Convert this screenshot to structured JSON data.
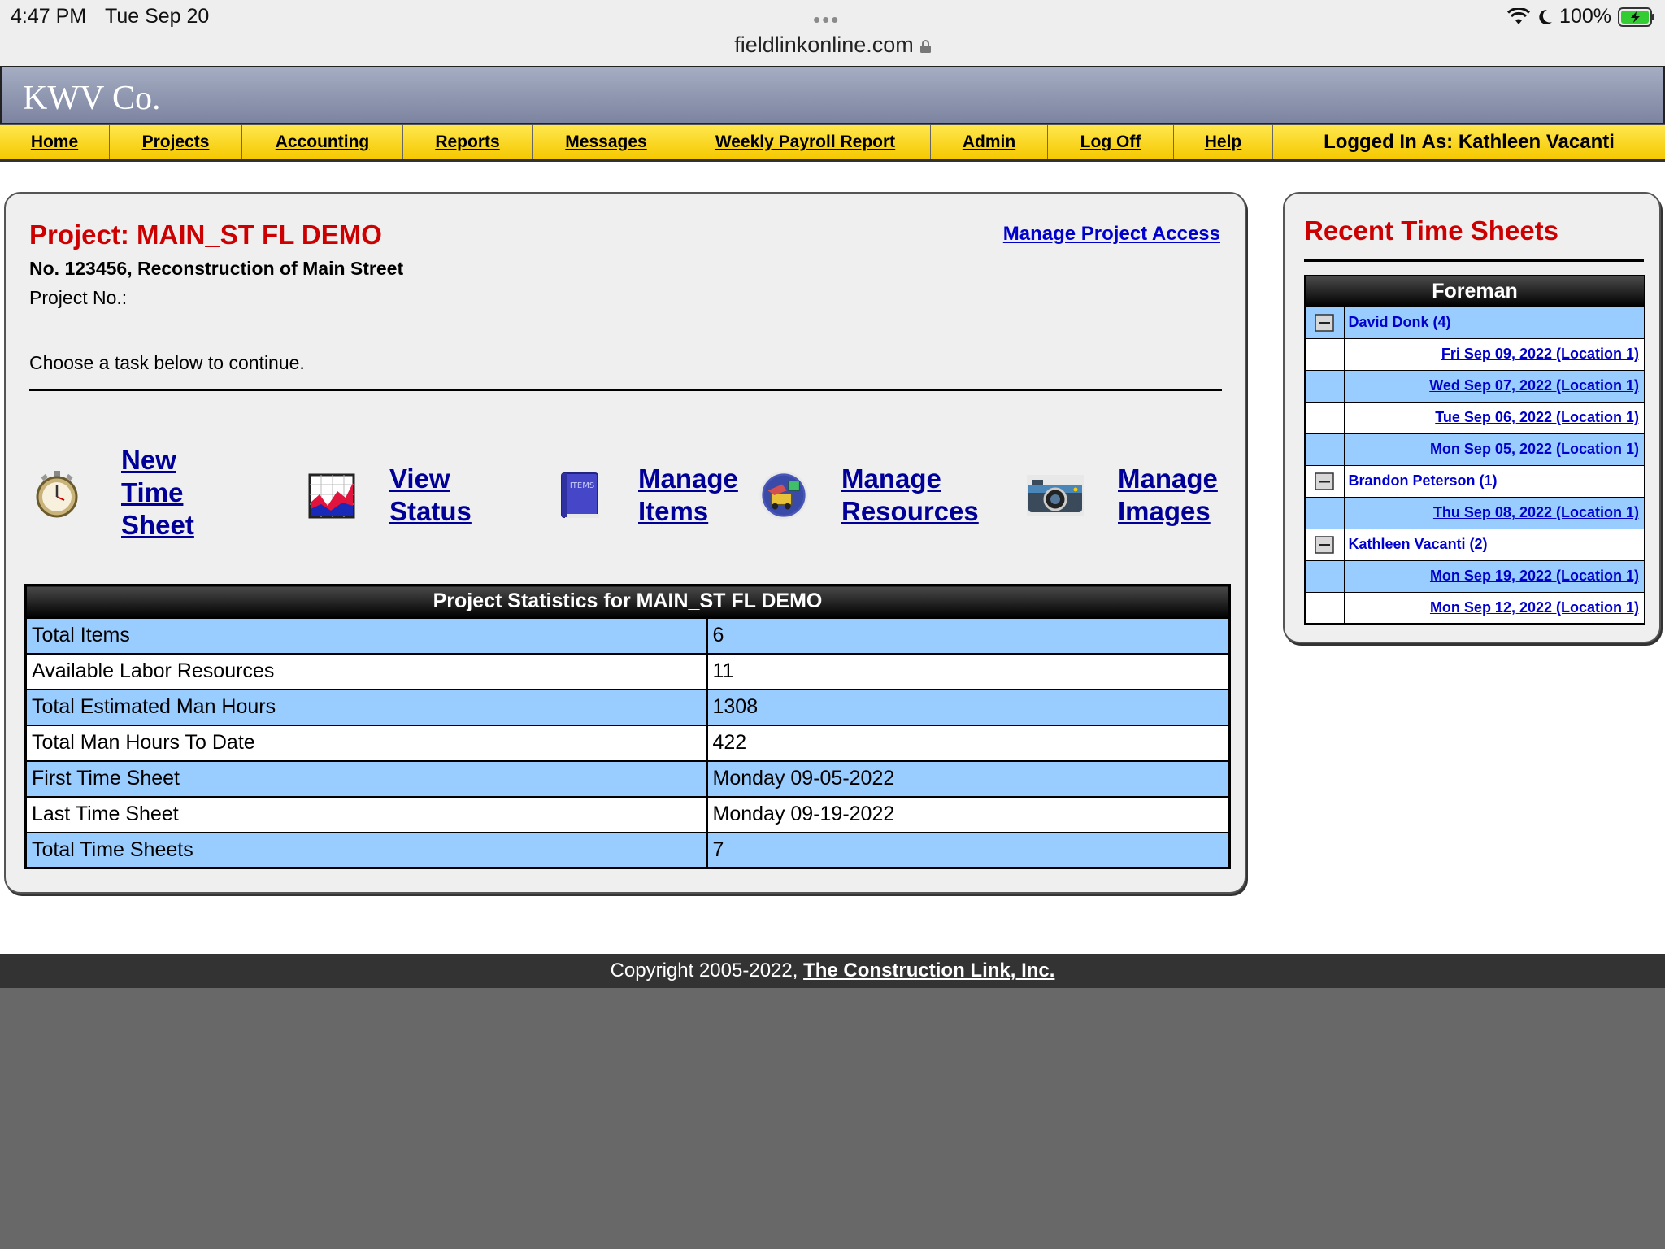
{
  "status_bar": {
    "time": "4:47 PM",
    "date": "Tue Sep 20",
    "battery": "100%"
  },
  "browser": {
    "dots": "•••",
    "url": "fieldlinkonline.com"
  },
  "banner": {
    "company": "KWV Co."
  },
  "nav": {
    "items": [
      "Home",
      "Projects",
      "Accounting",
      "Reports",
      "Messages",
      "Weekly Payroll Report",
      "Admin",
      "Log Off",
      "Help"
    ],
    "logged_in": "Logged In As: Kathleen Vacanti"
  },
  "project": {
    "title": "Project: MAIN_ST FL DEMO",
    "manage_access": "Manage Project Access",
    "description": "No. 123456, Reconstruction of Main Street",
    "project_no": "Project No.:",
    "choose_task": "Choose a task below to continue."
  },
  "tasks": {
    "new_time_sheet": [
      "New",
      "Time",
      "Sheet"
    ],
    "view_status": [
      "View",
      "Status"
    ],
    "manage_items": [
      "Manage",
      "Items"
    ],
    "manage_resources": [
      "Manage",
      "Resources"
    ],
    "manage_images": [
      "Manage",
      "Images"
    ],
    "items_icon_text": "ITEMS"
  },
  "stats": {
    "header": "Project Statistics for MAIN_ST FL DEMO",
    "rows": [
      {
        "label": "Total Items",
        "value": "6"
      },
      {
        "label": "Available Labor Resources",
        "value": "11"
      },
      {
        "label": "Total Estimated Man Hours",
        "value": "1308"
      },
      {
        "label": "Total Man Hours To Date",
        "value": "422"
      },
      {
        "label": "First Time Sheet",
        "value": "Monday 09-05-2022"
      },
      {
        "label": "Last Time Sheet",
        "value": "Monday 09-19-2022"
      },
      {
        "label": "Total Time Sheets",
        "value": "7"
      }
    ]
  },
  "recent": {
    "title": "Recent Time Sheets",
    "header": "Foreman",
    "groups": [
      {
        "name": "David Donk (4)",
        "dates": [
          "Fri Sep 09, 2022 (Location 1)",
          "Wed Sep 07, 2022 (Location 1)",
          "Tue Sep 06, 2022 (Location 1)",
          "Mon Sep 05, 2022 (Location 1)"
        ]
      },
      {
        "name": "Brandon Peterson (1)",
        "dates": [
          "Thu Sep 08, 2022 (Location 1)"
        ]
      },
      {
        "name": "Kathleen Vacanti (2)",
        "dates": [
          "Mon Sep 19, 2022 (Location 1)",
          "Mon Sep 12, 2022 (Location 1)"
        ]
      }
    ]
  },
  "footer": {
    "copyright": "Copyright 2005-2022, ",
    "link": "The Construction Link, Inc."
  },
  "colors": {
    "nav_yellow": "#f5c800",
    "row_blue": "#99ccff",
    "title_red": "#cc0000",
    "link_blue": "#0000cc"
  }
}
